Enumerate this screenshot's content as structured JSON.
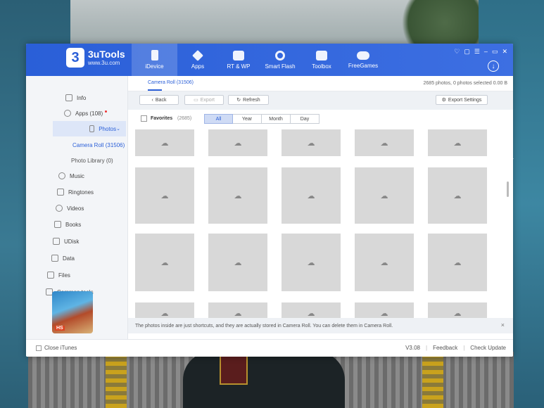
{
  "app": {
    "name": "3uTools",
    "url": "www.3u.com",
    "logo_digit": "3"
  },
  "nav": [
    {
      "label": "iDevice",
      "icon": "phone-icon",
      "active": true
    },
    {
      "label": "Apps",
      "icon": "cube-icon",
      "active": false
    },
    {
      "label": "RT & WP",
      "icon": "music-note-icon",
      "active": false
    },
    {
      "label": "Smart Flash",
      "icon": "flash-icon",
      "active": false
    },
    {
      "label": "Toolbox",
      "icon": "toolbox-icon",
      "active": false
    },
    {
      "label": "FreeGames",
      "icon": "gamepad-icon",
      "active": false
    }
  ],
  "window_controls": [
    "♡",
    "▢",
    "☰",
    "–",
    "▭",
    "✕"
  ],
  "download_glyph": "↓",
  "sidebar": {
    "items": [
      {
        "label": "Info",
        "icon": "info-icon"
      },
      {
        "label": "Apps",
        "count": "(108)",
        "icon": "apps-icon",
        "dot": true
      },
      {
        "label": "Photos",
        "icon": "photos-icon",
        "active": true,
        "chevron": "⌄"
      },
      {
        "label": "Camera Roll",
        "count": "(31506)",
        "sub": true,
        "active": true
      },
      {
        "label": "Photo Library",
        "count": "(0)",
        "sub": true
      },
      {
        "label": "Music",
        "icon": "music-icon"
      },
      {
        "label": "Ringtones",
        "icon": "bell-icon"
      },
      {
        "label": "Videos",
        "icon": "video-icon"
      },
      {
        "label": "Books",
        "icon": "book-icon"
      },
      {
        "label": "UDisk",
        "icon": "udisk-icon"
      },
      {
        "label": "Data",
        "icon": "data-icon"
      },
      {
        "label": "Files",
        "icon": "folder-icon"
      },
      {
        "label": "Common tools",
        "icon": "tools-icon"
      }
    ],
    "game_badge": "HS"
  },
  "main": {
    "tab": "Camera Roll (31506)",
    "count_info": "2685 photos, 0 photos selected 0.00 B",
    "toolbar": {
      "back": "Back",
      "export": "Export",
      "refresh": "Refresh",
      "export_settings": "Export Settings"
    },
    "filter": {
      "favorites": "Favorites",
      "favorites_count": "(2685)",
      "segments": [
        "All",
        "Year",
        "Month",
        "Day"
      ],
      "active_segment": "All"
    },
    "cell_glyph": "☁",
    "notice": "The photos inside are just shortcuts, and they are actually stored in Camera Roll. You can delete them in Camera Roll.",
    "notice_close": "×"
  },
  "status": {
    "close_itunes": "Close iTunes",
    "version": "V3.08",
    "feedback": "Feedback",
    "check_update": "Check Update",
    "separator": "|"
  }
}
